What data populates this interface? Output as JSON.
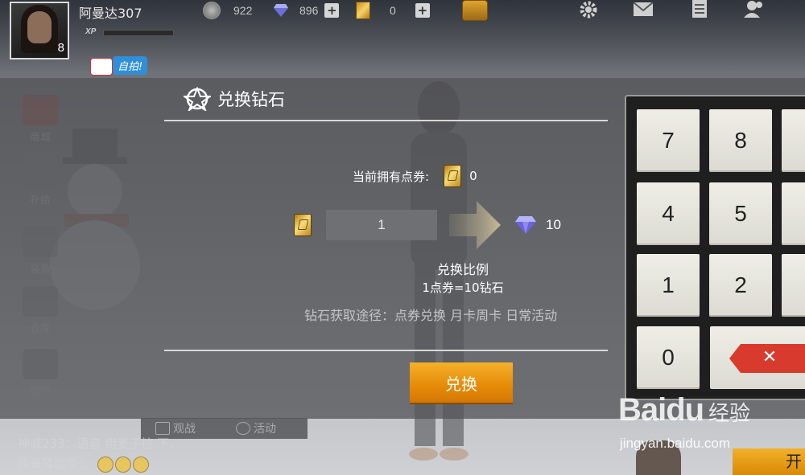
{
  "player": {
    "name": "阿曼达307",
    "level": "8",
    "xp_label": "XP"
  },
  "currencies": {
    "coins": "922",
    "diamonds": "896",
    "tickets": "0"
  },
  "selfie_label": "自拍!",
  "sidebar": [
    "商城",
    "补给",
    "装备",
    "仓库",
    "排行"
  ],
  "bottom_tabs": [
    "观战",
    "活动"
  ],
  "chat": [
    "神威233：语音 用麦子拉 下。",
    "伟哥降临中："
  ],
  "dialog": {
    "title": "兑换钻石",
    "owned_label": "当前拥有点券:",
    "owned_value": "0",
    "input_value": "1",
    "output_value": "10",
    "ratio_title": "兑换比例",
    "ratio_value": "1点券=10钻石",
    "ways": "钻石获取途径：点券兑换 月卡周卡 日常活动",
    "confirm_label": "兑换"
  },
  "keypad": {
    "keys": [
      "7",
      "8",
      "4",
      "5",
      "1",
      "2",
      "0"
    ],
    "delete_symbol": "✕"
  },
  "watermark": {
    "main": "Baidu",
    "cn": "经验",
    "url": "jingyan.baidu.com"
  },
  "corner_button": "开",
  "colors": {
    "confirm": "#e58b07",
    "delete": "#d93a2e",
    "keypad_bg": "#1f1f20",
    "key_face": "#efeee6"
  }
}
